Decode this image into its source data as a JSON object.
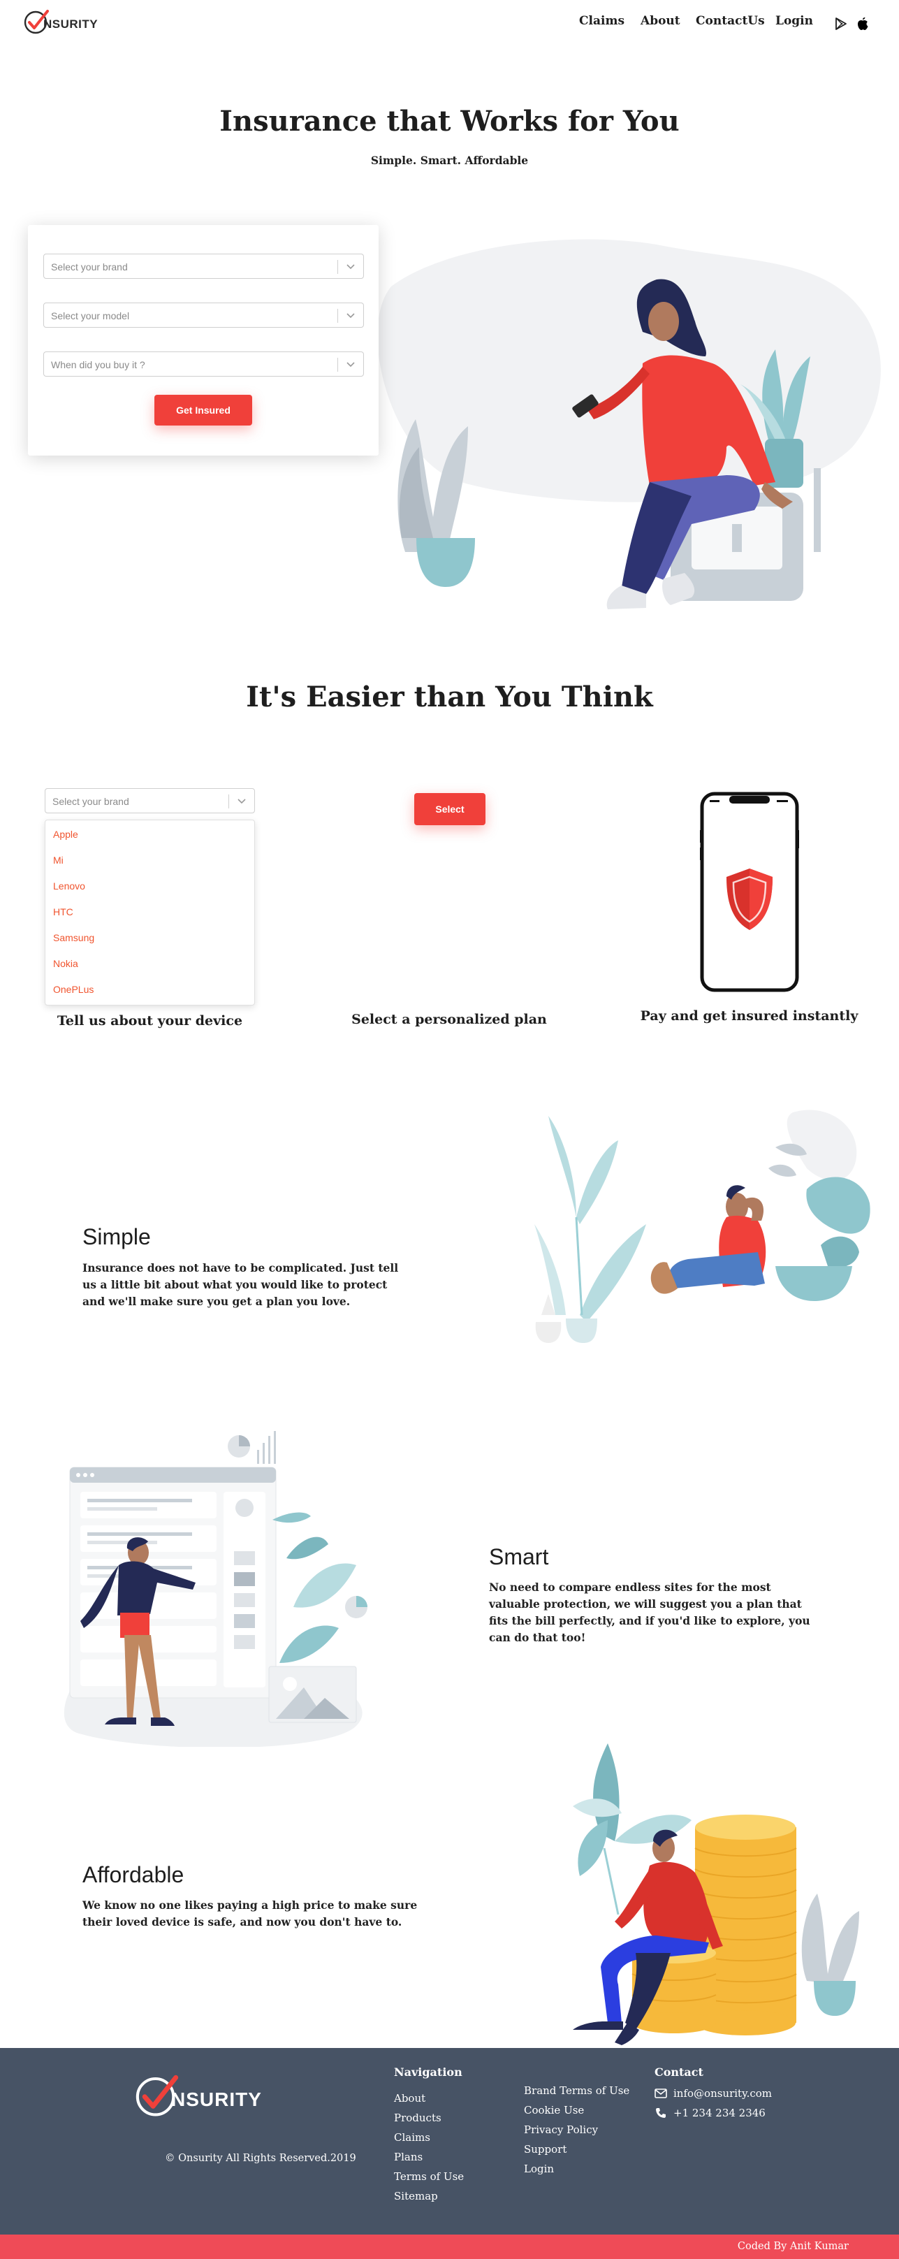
{
  "header": {
    "logo_text": "NSURITY",
    "nav": [
      "Claims",
      "About",
      "ContactUs",
      "Login"
    ],
    "icons": [
      "google-play-icon",
      "apple-icon"
    ]
  },
  "hero": {
    "title": "Insurance that Works for You",
    "subtitle": "Simple. Smart. Affordable",
    "form": {
      "brand_placeholder": "Select your brand",
      "model_placeholder": "Select your model",
      "date_placeholder": "When did you buy it ?",
      "submit_label": "Get Insured"
    }
  },
  "steps": {
    "title": "It's Easier than You Think",
    "brand_placeholder": "Select your brand",
    "brand_options": [
      "Apple",
      "Mi",
      "Lenovo",
      "HTC",
      "Samsung",
      "Nokia",
      "OnePLus"
    ],
    "select_label": "Select",
    "captions": [
      "Tell us about your device",
      "Select a personalized plan",
      "Pay and get insured instantly"
    ]
  },
  "features": [
    {
      "title": "Simple",
      "body": "Insurance does not have to be complicated. Just tell us a little bit about what you would like to protect and we'll make sure you get a plan you love."
    },
    {
      "title": "Smart",
      "body": "No need to compare endless sites for the most valuable protection, we will suggest you a plan that fits the bill perfectly, and if you'd like to explore, you can do that too!"
    },
    {
      "title": "Affordable",
      "body": "We know no one likes paying a high price to make sure their loved device is safe, and now you don't have to."
    }
  ],
  "footer": {
    "logo_text": "NSURITY",
    "copyright": "© Onsurity  All Rights Reserved.2019",
    "nav_heading": "Navigation",
    "nav_links": [
      "About",
      "Products",
      "Claims",
      "Plans",
      "Terms of Use",
      "Sitemap"
    ],
    "legal_links": [
      "Brand Terms of Use",
      "Cookie Use",
      "Privacy Policy",
      "Support",
      "Login"
    ],
    "contact_heading": "Contact",
    "email": "info@onsurity.com",
    "phone": "+1 234 234 2346",
    "credit": "Coded By Anit Kumar"
  },
  "colors": {
    "accent": "#f0403a",
    "footer_bg": "#475365",
    "credit_bar": "#ef4b57",
    "teal": "#8fc6cd",
    "navy": "#2d3371"
  }
}
